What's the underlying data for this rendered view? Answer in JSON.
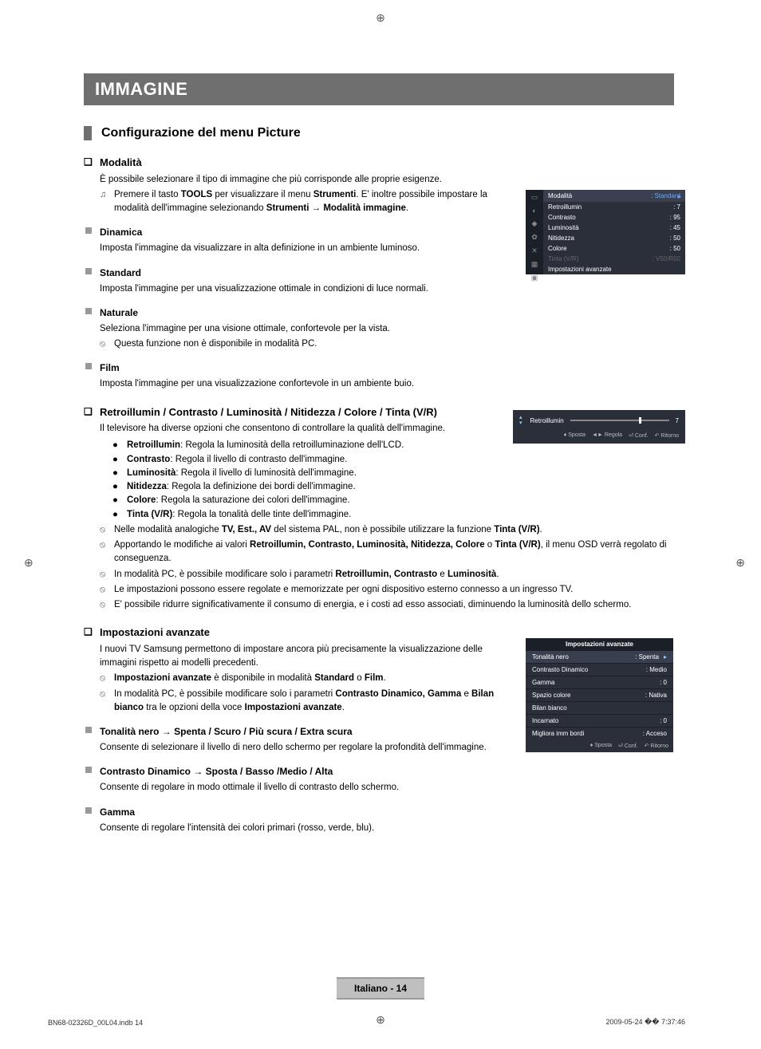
{
  "section_title": "IMMAGINE",
  "subhead": "Configurazione del menu Picture",
  "modalita": {
    "title": "Modalità",
    "intro": "È possibile selezionare il tipo di immagine che più corrisponde alle proprie esigenze.",
    "tools_pre": "Premere il tasto ",
    "tools_b1": "TOOLS",
    "tools_mid1": " per visualizzare il menu ",
    "tools_b2": "Strumenti",
    "tools_mid2": ". E' inoltre possibile impostare la modalità dell'immagine selezionando ",
    "tools_b3": "Strumenti → Modalità immagine",
    "dinamica_t": "Dinamica",
    "dinamica_b": "Imposta l'immagine da visualizzare in alta definizione in un ambiente luminoso.",
    "standard_t": "Standard",
    "standard_b": "Imposta l'immagine per una visualizzazione ottimale in condizioni di luce normali.",
    "naturale_t": "Naturale",
    "naturale_b": "Seleziona l'immagine per una visione ottimale, confortevole per la vista.",
    "naturale_n": "Questa funzione non è disponibile in modalità PC.",
    "film_t": "Film",
    "film_b": "Imposta l'immagine per una visualizzazione confortevole in un ambiente buio."
  },
  "retro": {
    "title": "Retroillumin / Contrasto / Luminosità / Nitidezza / Colore / Tinta (V/R)",
    "intro": "Il televisore ha diverse opzioni che consentono di controllare la qualità dell'immagine.",
    "b1": "Retroillumin",
    "d1": ": Regola la luminosità della retroilluminazione dell'LCD.",
    "b2": "Contrasto",
    "d2": ": Regola il livello di contrasto dell'immagine.",
    "b3": "Luminosità",
    "d3": ": Regola il livello di luminosità dell'immagine.",
    "b4": "Nitidezza",
    "d4": ": Regola la definizione dei bordi dell'immagine.",
    "b5": "Colore",
    "d5": ": Regola la saturazione dei colori dell'immagine.",
    "b6": "Tinta (V/R)",
    "d6": ": Regola la tonalità delle tinte dell'immagine.",
    "n1_pre": "Nelle modalità analogiche ",
    "n1_b": "TV, Est., AV",
    "n1_mid": " del sistema PAL, non è possibile utilizzare la funzione ",
    "n1_b2": "Tinta (V/R)",
    "n1_post": ".",
    "n2_pre": "Apportando le modifiche ai valori ",
    "n2_b": "Retroillumin, Contrasto, Luminosità, Nitidezza, Colore",
    "n2_mid": " o ",
    "n2_b2": "Tinta (V/R)",
    "n2_post": ", il menu OSD verrà regolato di conseguenza.",
    "n3_pre": "In modalità PC, è possibile modificare solo i parametri ",
    "n3_b": "Retroillumin, Contrasto",
    "n3_mid": " e ",
    "n3_b2": "Luminosità",
    "n3_post": ".",
    "n4": "Le impostazioni possono essere regolate e memorizzate per ogni dispositivo esterno connesso a un ingresso TV.",
    "n5": "E' possibile ridurre significativamente il consumo di energia, e i costi ad esso associati, diminuendo la luminosità dello schermo."
  },
  "imp": {
    "title": "Impostazioni avanzate",
    "intro": "I nuovi TV Samsung permettono di impostare ancora più precisamente la visualizzazione delle immagini rispetto ai modelli precedenti.",
    "n1_b": "Impostazioni avanzate",
    "n1_mid": " è disponibile in modalità ",
    "n1_b2": "Standard",
    "n1_or": " o ",
    "n1_b3": "Film",
    "n1_post": ".",
    "n2_pre": "In modalità PC, è possibile modificare solo i parametri ",
    "n2_b": "Contrasto Dinamico, Gamma",
    "n2_mid": " e ",
    "n2_b2": "Bilan bianco",
    "n2_mid2": " tra le opzioni della voce ",
    "n2_b3": "Impostazioni avanzate",
    "n2_post": ".",
    "ton_t": "Tonalità nero → Spenta / Scuro / Più scura / Extra scura",
    "ton_b": "Consente di selezionare il livello di nero dello schermo per regolare la profondità dell'immagine.",
    "con_t": "Contrasto Dinamico → Sposta / Basso /Medio / Alta",
    "con_b": "Consente di regolare in modo ottimale il livello di contrasto dello schermo.",
    "gam_t": "Gamma",
    "gam_b": "Consente di regolare l'intensità dei colori primari (rosso, verde, blu)."
  },
  "osd1": {
    "mode": "Modalità",
    "mode_v": ": Standard",
    "r1": "Retroillumin",
    "v1": ": 7",
    "r2": "Contrasto",
    "v2": ": 95",
    "r3": "Luminosità",
    "v3": ": 45",
    "r4": "Nitidezza",
    "v4": ": 50",
    "r5": "Colore",
    "v5": ": 50",
    "r6": "Tinta (V/R)",
    "v6": ": V50/R50",
    "r7": "Impostazioni avanzate"
  },
  "osd2": {
    "label": "Retroillumin",
    "value": "7",
    "h1": "Sposta",
    "h2": "Regola",
    "h3": "Conf.",
    "h4": "Ritorno"
  },
  "osd3": {
    "title": "Impostazioni avanzate",
    "r1": "Tonalità nero",
    "v1": ": Spenta",
    "r2": "Contrasto Dinamico",
    "v2": ": Medio",
    "r3": "Gamma",
    "v3": ": 0",
    "r4": "Spazio colore",
    "v4": ": Nativa",
    "r5": "Bilan bianco",
    "v5": "",
    "r6": "Incarnato",
    "v6": ": 0",
    "r7": "Migliora imm bordi",
    "v7": ": Acceso",
    "h1": "Sposta",
    "h2": "Conf.",
    "h3": "Ritorno"
  },
  "footer": "Italiano - 14",
  "tiny_l": "BN68-02326D_00L04.indb   14",
  "tiny_r": "2009-05-24   �� 7:37:46"
}
